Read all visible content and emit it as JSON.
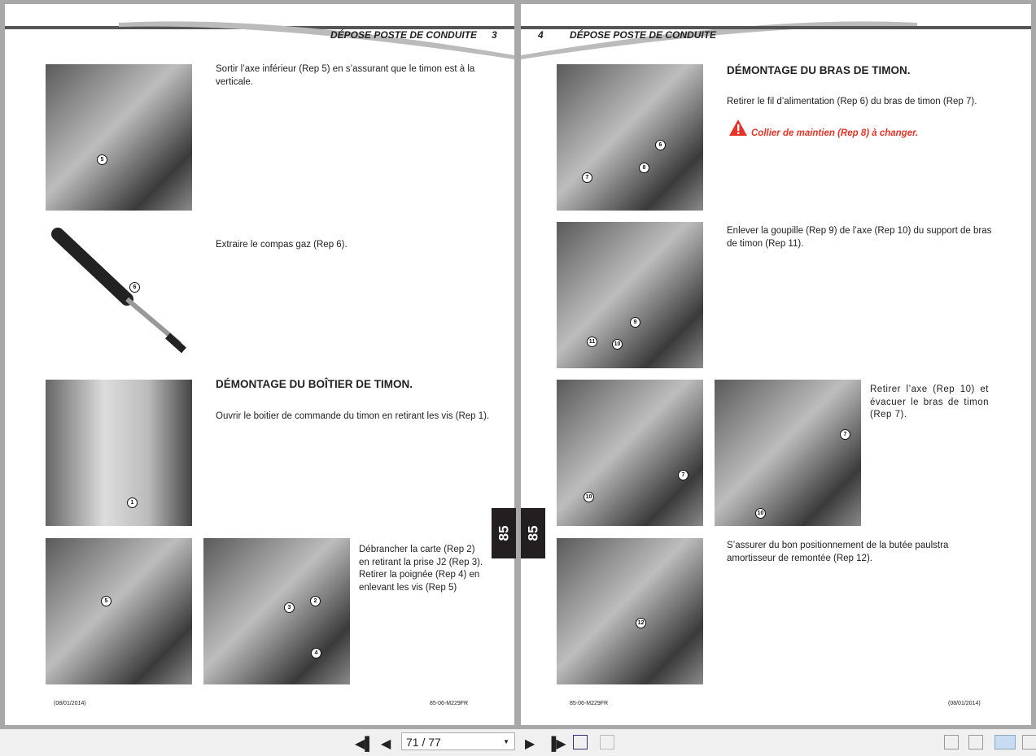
{
  "left_page": {
    "header": "DÉPOSE POSTE DE CONDUITE",
    "page_number": "3",
    "step1": "Sortir l’axe inférieur (Rep 5) en s’assurant que le timon est à la verticale.",
    "step2": "Extraire le compas gaz (Rep 6).",
    "section_title": "DÉMONTAGE DU BOÎTIER DE TIMON.",
    "step3": "Ouvrir le boitier de commande du timon en retirant les vis (Rep 1).",
    "step4": "Débrancher la carte (Rep 2) en retirant la prise J2 (Rep 3). Retirer la poignée (Rep 4) en enlevant les vis (Rep 5)",
    "footer_date": "(08/01/2014)",
    "footer_ref": "85-06-M229FR",
    "tab": "85",
    "callouts": {
      "img1": [
        "5"
      ],
      "img2": [
        "6"
      ],
      "img3": [
        "1"
      ],
      "img4": [
        "5"
      ],
      "img5": [
        "2",
        "3",
        "4"
      ]
    }
  },
  "right_page": {
    "header": "DÉPOSE POSTE DE CONDUITE",
    "page_number": "4",
    "section_title": "DÉMONTAGE DU BRAS DE TIMON.",
    "step1": "Retirer le fil d’alimentation (Rep 6) du bras de timon (Rep 7).",
    "warning": "Collier de maintien (Rep 8) à changer.",
    "step2": "Enlever la goupille (Rep 9) de l’axe (Rep 10) du support de bras de timon (Rep 11).",
    "step3": "Retirer l’axe (Rep 10) et évacuer le bras de timon (Rep 7).",
    "step4": "S’assurer du bon positionnement de la butée paulstra amortisseur de remontée (Rep 12).",
    "footer_date": "(08/01/2014)",
    "footer_ref": "85-06-M229FR",
    "tab": "85",
    "warning_color": "#e63329",
    "callouts": {
      "img1": [
        "6",
        "8",
        "7"
      ],
      "img2": [
        "9",
        "10",
        "11"
      ],
      "img3": [
        "7",
        "10"
      ],
      "img4": [
        "7",
        "10"
      ],
      "img5": [
        "12"
      ]
    }
  },
  "toolbar": {
    "page_indicator": "71 / 77"
  }
}
